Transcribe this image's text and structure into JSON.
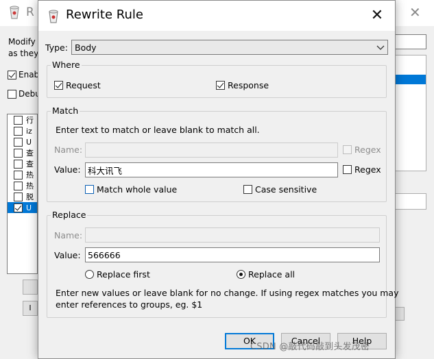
{
  "background_window": {
    "title_fragment": "R",
    "desc_lines": [
      "Modify",
      "as they"
    ],
    "checkboxes": [
      {
        "label": "Enab",
        "checked": true
      },
      {
        "label": "Debu",
        "checked": false
      }
    ],
    "list_items": [
      {
        "text": "行",
        "checked": false,
        "selected": false
      },
      {
        "text": "iz",
        "checked": false,
        "selected": false
      },
      {
        "text": "U",
        "checked": false,
        "selected": false
      },
      {
        "text": "查",
        "checked": false,
        "selected": false
      },
      {
        "text": "查",
        "checked": false,
        "selected": false
      },
      {
        "text": "热",
        "checked": false,
        "selected": false
      },
      {
        "text": "热",
        "checked": false,
        "selected": false
      },
      {
        "text": "脱",
        "checked": false,
        "selected": false
      },
      {
        "text": "U",
        "checked": true,
        "selected": true
      }
    ],
    "button_fragment": "I"
  },
  "dialog": {
    "title": "Rewrite Rule",
    "type_label": "Type:",
    "type_value": "Body",
    "where": {
      "legend": "Where",
      "request_label": "Request",
      "request_checked": true,
      "response_label": "Response",
      "response_checked": true
    },
    "match": {
      "legend": "Match",
      "instruction": "Enter text to match or leave blank to match all.",
      "name_label": "Name:",
      "name_value": "",
      "name_regex_label": "Regex",
      "value_label": "Value:",
      "value_value": "科大讯飞",
      "value_regex_label": "Regex",
      "match_whole_label": "Match whole value",
      "case_sensitive_label": "Case sensitive"
    },
    "replace": {
      "legend": "Replace",
      "name_label": "Name:",
      "name_value": "",
      "value_label": "Value:",
      "value_value": "566666",
      "replace_first_label": "Replace first",
      "replace_all_label": "Replace all",
      "selected_mode": "Replace all",
      "help_line1": "Enter new values or leave blank for no change. If using regex matches you may",
      "help_line2": "enter references to groups, eg. $1"
    },
    "buttons": {
      "ok": "OK",
      "cancel": "Cancel",
      "help": "Help"
    }
  },
  "watermark": "CSDN @敲代码敲到头发茂密",
  "colors": {
    "selection": "#0078d7",
    "dialog_bg": "#f0f0f0",
    "titlebar_bg": "#ffffff"
  },
  "icons": [
    "app-icon",
    "close-icon",
    "chevron-down-icon"
  ]
}
